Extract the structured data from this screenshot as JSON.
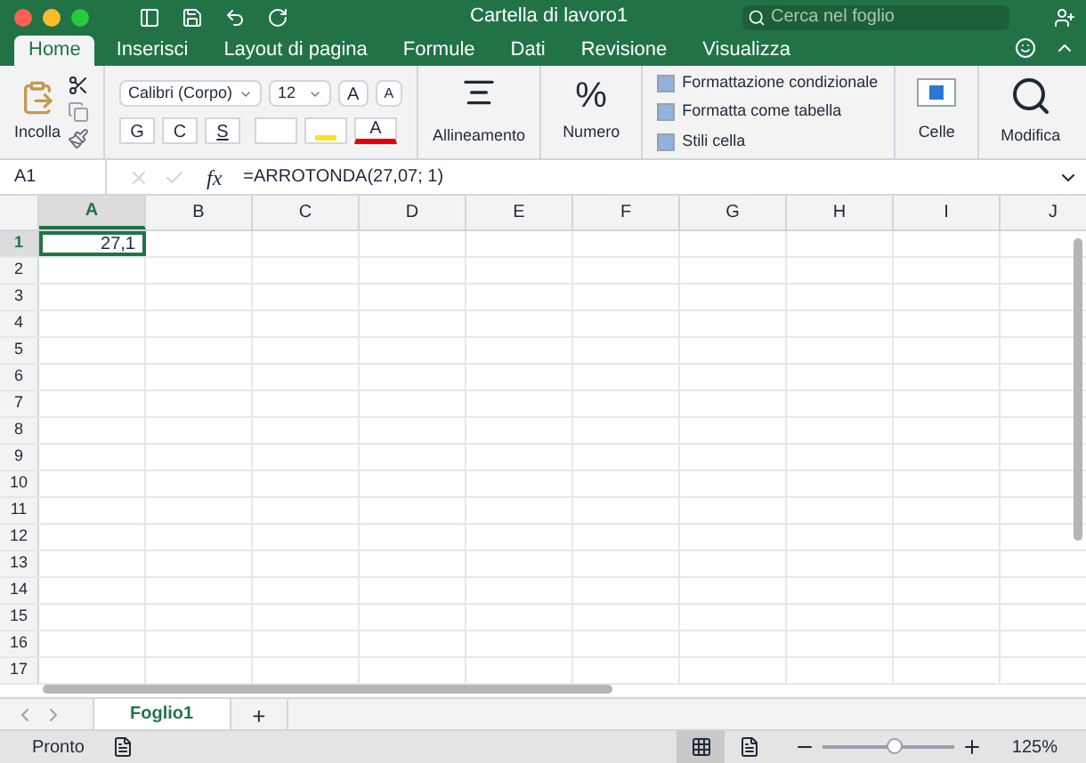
{
  "window": {
    "title": "Cartella di lavoro1",
    "search_placeholder": "Cerca nel foglio"
  },
  "tabs": [
    {
      "label": "Home",
      "selected": true
    },
    {
      "label": "Inserisci",
      "selected": false
    },
    {
      "label": "Layout di pagina",
      "selected": false
    },
    {
      "label": "Formule",
      "selected": false
    },
    {
      "label": "Dati",
      "selected": false
    },
    {
      "label": "Revisione",
      "selected": false
    },
    {
      "label": "Visualizza",
      "selected": false
    }
  ],
  "ribbon": {
    "paste_label": "Incolla",
    "font_name": "Calibri (Corpo)",
    "font_size": "12",
    "grow_font": "A",
    "shrink_font": "A",
    "style_buttons": [
      "G",
      "C",
      "S"
    ],
    "font_color_letter": "A",
    "alignment_label": "Allineamento",
    "number_symbol": "%",
    "number_label": "Numero",
    "styles": [
      "Formattazione condizionale",
      "Formatta come tabella",
      "Stili cella"
    ],
    "cells_label": "Celle",
    "edit_label": "Modifica"
  },
  "formula_bar": {
    "name_box": "A1",
    "fx": "fx",
    "formula": "=ARROTONDA(27,07; 1)"
  },
  "sheet": {
    "columns": [
      {
        "label": "A",
        "selected": true
      },
      {
        "label": "B",
        "selected": false
      },
      {
        "label": "C",
        "selected": false
      },
      {
        "label": "D",
        "selected": false
      },
      {
        "label": "E",
        "selected": false
      },
      {
        "label": "F",
        "selected": false
      },
      {
        "label": "G",
        "selected": false
      },
      {
        "label": "H",
        "selected": false
      },
      {
        "label": "I",
        "selected": false
      },
      {
        "label": "J",
        "selected": false
      }
    ],
    "rows": [
      {
        "label": "1",
        "selected": true,
        "cells": [
          "27,1"
        ]
      },
      {
        "label": "2",
        "selected": false
      },
      {
        "label": "3",
        "selected": false
      },
      {
        "label": "4",
        "selected": false
      },
      {
        "label": "5",
        "selected": false
      },
      {
        "label": "6",
        "selected": false
      },
      {
        "label": "7",
        "selected": false
      },
      {
        "label": "8",
        "selected": false
      },
      {
        "label": "9",
        "selected": false
      },
      {
        "label": "10",
        "selected": false
      },
      {
        "label": "11",
        "selected": false
      },
      {
        "label": "12",
        "selected": false
      },
      {
        "label": "13",
        "selected": false
      },
      {
        "label": "14",
        "selected": false
      },
      {
        "label": "15",
        "selected": false
      },
      {
        "label": "16",
        "selected": false
      },
      {
        "label": "17",
        "selected": false
      }
    ]
  },
  "sheet_tabs": [
    {
      "label": "Foglio1",
      "selected": true
    }
  ],
  "add_sheet": "+",
  "status_bar": {
    "status": "Pronto",
    "views": [
      {
        "kind": "normal",
        "selected": true
      },
      {
        "kind": "page",
        "selected": false
      }
    ],
    "zoom": {
      "level": 0.53
    },
    "zoom_text": "125%"
  }
}
